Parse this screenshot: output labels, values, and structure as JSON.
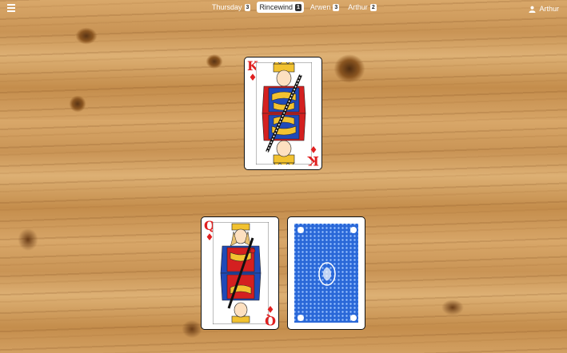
{
  "players": [
    {
      "name": "Thursday",
      "count": "3",
      "active": false
    },
    {
      "name": "Rincewind",
      "count": "1",
      "active": true
    },
    {
      "name": "Arwen",
      "count": "3",
      "active": false
    },
    {
      "name": "Arthur",
      "count": "2",
      "active": false
    }
  ],
  "user": {
    "name": "Arthur",
    "icon": "person-icon"
  },
  "menu_icon": "hamburger-icon",
  "table": {
    "played_card": {
      "rank": "K",
      "suit": "♦",
      "label": "King of Diamonds",
      "color": "#e02020"
    },
    "hand": [
      {
        "rank": "Q",
        "suit": "♦",
        "label": "Queen of Diamonds",
        "face_up": true,
        "color": "#e02020"
      },
      {
        "label": "Face-down card",
        "face_up": false,
        "back_color": "#2a68d8"
      }
    ]
  }
}
